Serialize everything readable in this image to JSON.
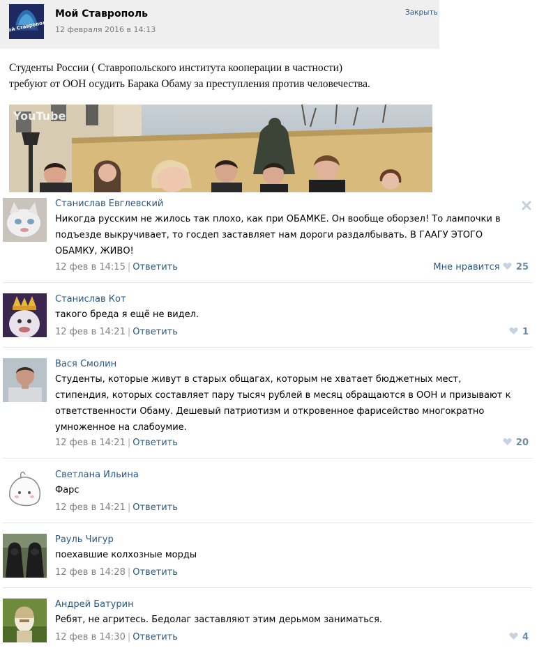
{
  "post": {
    "group_name": "Мой Ставрополь",
    "date": "12 февраля 2016 в 14:13",
    "close_label": "Закрыть",
    "avatar_text": "Мой Ставрополь",
    "text_lines": [
      "Студенты России ( Ставропольского института кооперации в частности)",
      "требуют от ООН осудить Барака Обаму за преступления против человечества."
    ],
    "video_brand": "YouTube"
  },
  "reply_label": "Ответить",
  "like_label": "Мне нравится",
  "comments": [
    {
      "author": "Станислав Евглевский",
      "lines": [
        "Никогда русским не жилось так плохо, как при ОБАМКЕ. Он вообще оборзел! То лампочки в",
        "подъезде выкручивает, то госдеп заставляет нам дороги раздалбывать. В ГААГУ ЭТОГО",
        "ОБАМКУ, ЖИВО!"
      ],
      "time": "12 фев в 14:15",
      "likes": "25"
    },
    {
      "author": "Станислав Кот",
      "lines": [
        "такого бреда я ещё не видел."
      ],
      "time": "12 фев в 14:21",
      "likes": "1"
    },
    {
      "author": "Вася Смолин",
      "lines": [
        "Студенты, которые живут в старых общагах, которым не хватает бюджетных мест,",
        "стипендия, которых составляет пару тысяч рублей в месяц обращаются в ООН и призывают к",
        "ответственности Обаму. Дешевый патриотизм и откровенное фарисейство многократно",
        "умноженное на слабоумие."
      ],
      "time": "12 фев в 14:21",
      "likes": "20"
    },
    {
      "author": "Светлана Ильина",
      "lines": [
        "Фарс"
      ],
      "time": "12 фев в 14:21",
      "likes": ""
    },
    {
      "author": "Рауль Чигур",
      "lines": [
        "поехавшие колхозные морды"
      ],
      "time": "12 фев в 14:28",
      "likes": ""
    },
    {
      "author": "Андрей Батурин",
      "lines": [
        "Ребят, не агритесь. Бедолаг заставляют этим дерьмом заниматься."
      ],
      "time": "12 фев в 14:30",
      "likes": "4"
    }
  ]
}
